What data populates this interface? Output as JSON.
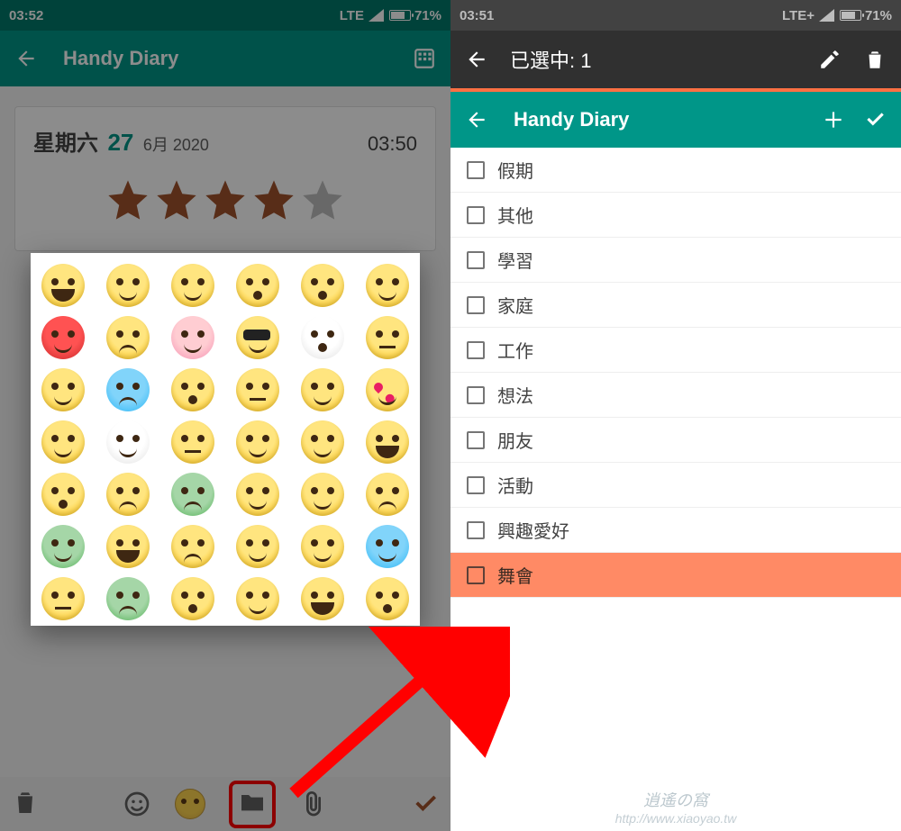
{
  "left": {
    "status": {
      "clock": "03:52",
      "net": "LTE",
      "battery": "71%"
    },
    "toolbar": {
      "title": "Handy Diary"
    },
    "entry": {
      "weekday": "星期六",
      "day": "27",
      "month_year": "6月 2020",
      "time": "03:50",
      "stars_filled": 4,
      "stars_total": 5
    },
    "bottom_icons": [
      "trash-icon",
      "smiley-outline-icon",
      "smiley-filled-icon",
      "folder-icon",
      "paperclip-icon",
      "check-icon"
    ]
  },
  "right": {
    "status": {
      "clock": "03:51",
      "net": "LTE+",
      "battery": "71%"
    },
    "select_toolbar": {
      "title": "已選中: 1"
    },
    "app_toolbar": {
      "title": "Handy Diary"
    },
    "categories": [
      {
        "label": "假期",
        "selected": false
      },
      {
        "label": "其他",
        "selected": false
      },
      {
        "label": "學習",
        "selected": false
      },
      {
        "label": "家庭",
        "selected": false
      },
      {
        "label": "工作",
        "selected": false
      },
      {
        "label": "想法",
        "selected": false
      },
      {
        "label": "朋友",
        "selected": false
      },
      {
        "label": "活動",
        "selected": false
      },
      {
        "label": "興趣愛好",
        "selected": false
      },
      {
        "label": "舞會",
        "selected": true
      }
    ]
  },
  "watermark": {
    "line1": "逍遙の窩",
    "line2": "http://www.xiaoyao.tw"
  }
}
